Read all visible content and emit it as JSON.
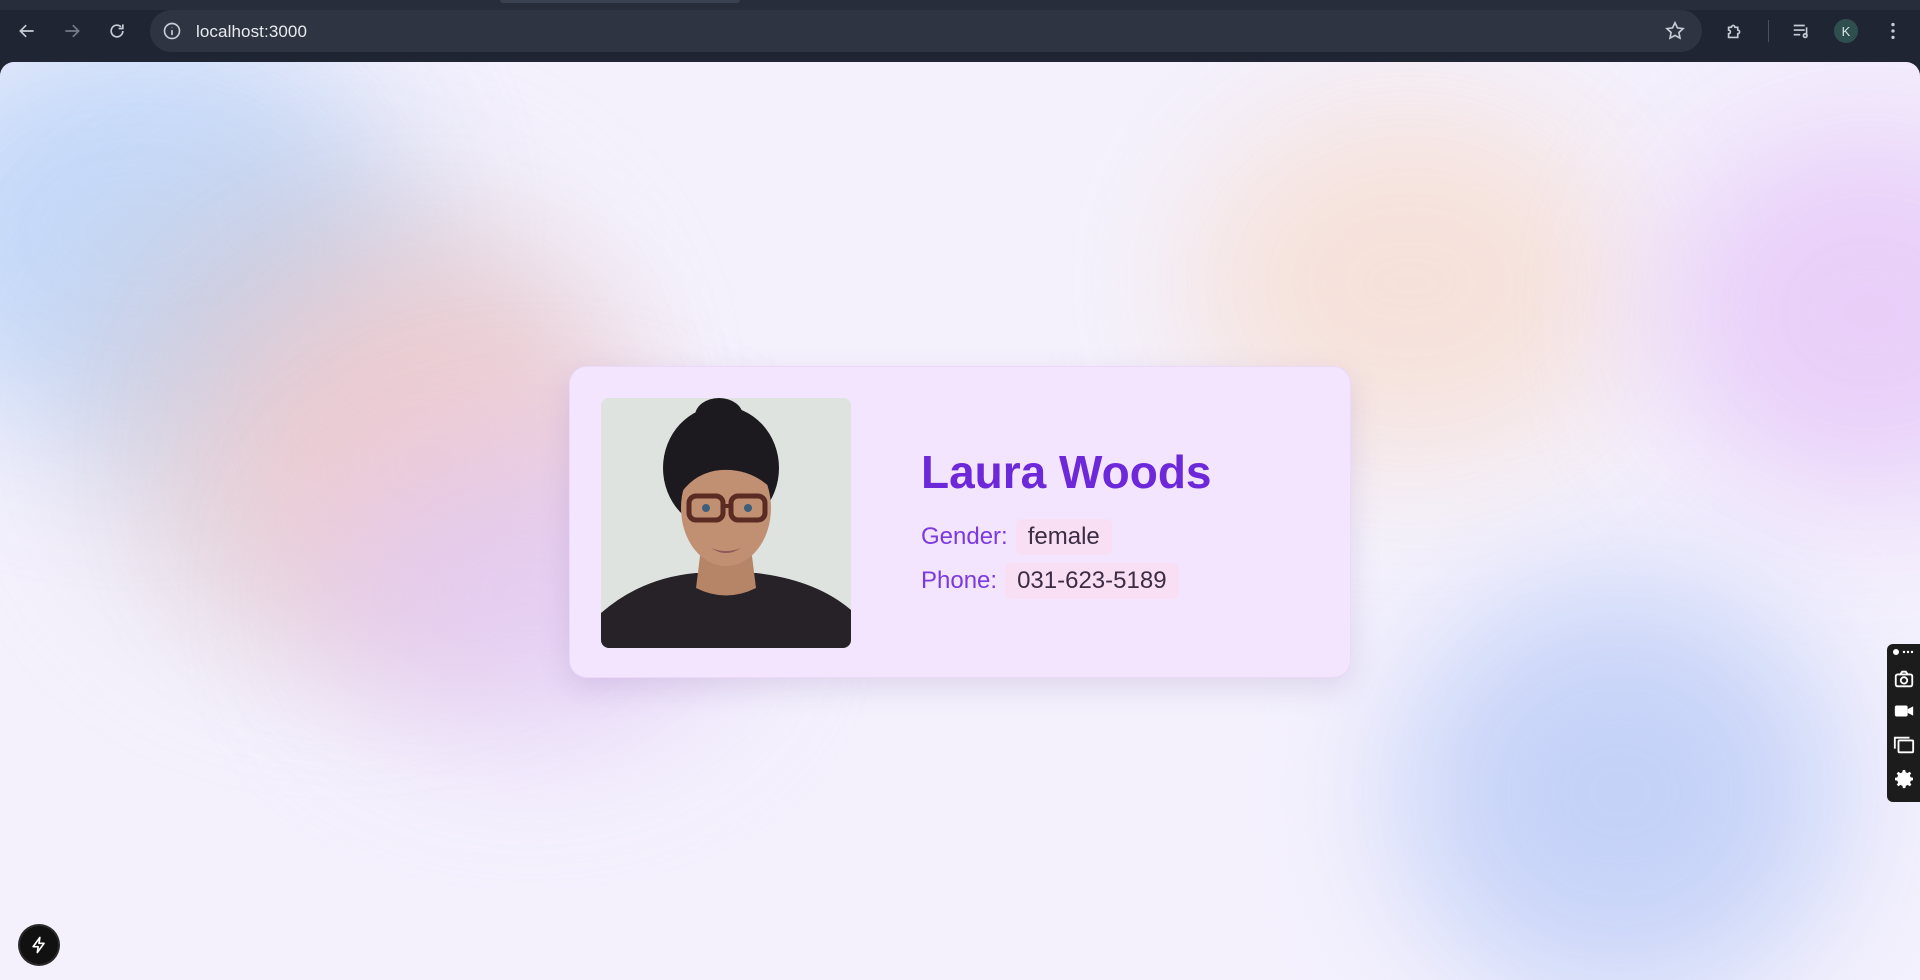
{
  "browser": {
    "url": "localhost:3000",
    "profile_initial": "K",
    "icons": {
      "back": "arrow-left-icon",
      "forward": "arrow-right-icon",
      "reload": "reload-icon",
      "site_info": "info-icon",
      "bookmark": "star-icon",
      "extensions": "puzzle-icon",
      "media": "media-controls-icon",
      "menu": "kebab-menu-icon"
    }
  },
  "profile": {
    "name": "Laura Woods",
    "gender_label": "Gender:",
    "gender": "female",
    "phone_label": "Phone:",
    "phone": "031-623-5189"
  },
  "colors": {
    "accent": "#6d28d9",
    "card_bg": "#f3e5fd",
    "value_bg": "#f9dff3",
    "page_bg": "#f4f1fd"
  },
  "side_toolbar": {
    "items": [
      "camera-icon",
      "video-icon",
      "windows-icon",
      "gear-icon"
    ]
  },
  "dev_indicator": {
    "icon": "lightning-icon"
  }
}
